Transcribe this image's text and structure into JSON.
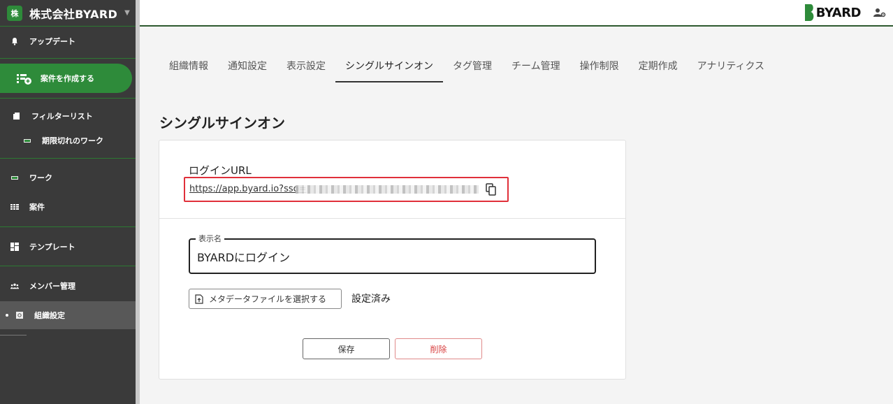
{
  "sidebar": {
    "org_name": "株式会社BYARD",
    "org_logo_text": "株",
    "items": [
      {
        "label": "アップデート",
        "icon": "bell-icon"
      },
      {
        "label": "案件を作成する",
        "icon": "create-project-icon"
      },
      {
        "label": "フィルターリスト",
        "icon": "bookmark-icon"
      },
      {
        "label": "期限切れのワーク",
        "icon": "filter-item-icon"
      },
      {
        "label": "ワーク",
        "icon": "work-icon"
      },
      {
        "label": "案件",
        "icon": "grid-icon"
      },
      {
        "label": "テンプレート",
        "icon": "template-icon"
      },
      {
        "label": "メンバー管理",
        "icon": "members-icon"
      },
      {
        "label": "組織設定",
        "icon": "settings-icon"
      }
    ]
  },
  "topbar": {
    "brand": "BYARD",
    "brand_color": "#2e8b3a"
  },
  "tabs": [
    {
      "label": "組織情報"
    },
    {
      "label": "通知設定"
    },
    {
      "label": "表示設定"
    },
    {
      "label": "シングルサインオン",
      "active": true
    },
    {
      "label": "タグ管理"
    },
    {
      "label": "チーム管理"
    },
    {
      "label": "操作制限"
    },
    {
      "label": "定期作成"
    },
    {
      "label": "アナリティクス"
    }
  ],
  "page": {
    "title": "シングルサインオン",
    "login_url_label": "ログインURL",
    "login_url": "https://app.byard.io?sso=",
    "display_name_legend": "表示名",
    "display_name_value": "BYARDにログイン",
    "metadata_button": "メタデータファイルを選択する",
    "metadata_status": "設定済み",
    "save_button": "保存",
    "delete_button": "削除"
  },
  "colors": {
    "accent": "#2e8b3a",
    "sidebar_bg": "#3a3a3a",
    "highlight_border": "#e0303a",
    "delete_text": "#d84040"
  }
}
